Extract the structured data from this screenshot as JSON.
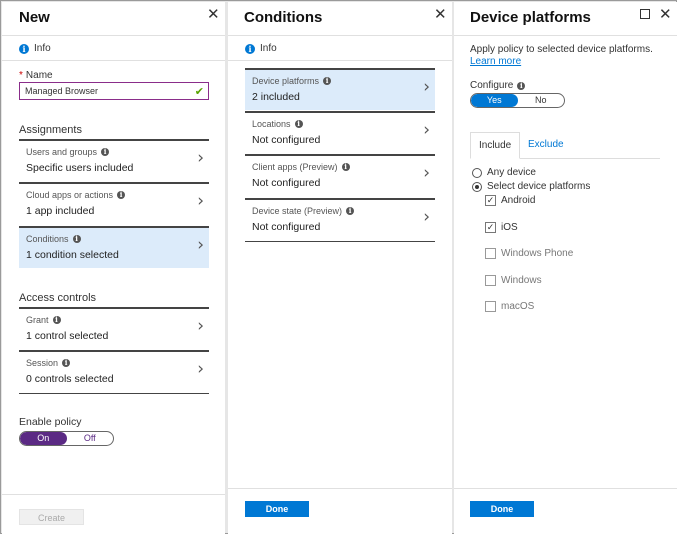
{
  "blade_new": {
    "title": "New",
    "info_label": "Info",
    "name_label": "Name",
    "name_value": "Managed Browser",
    "assignments_heading": "Assignments",
    "assignments": [
      {
        "title": "Users and groups",
        "value": "Specific users included"
      },
      {
        "title": "Cloud apps or actions",
        "value": "1 app included"
      },
      {
        "title": "Conditions",
        "value": "1 condition selected"
      }
    ],
    "access_heading": "Access controls",
    "access": [
      {
        "title": "Grant",
        "value": "1 control selected"
      },
      {
        "title": "Session",
        "value": "0 controls selected"
      }
    ],
    "enable_policy_label": "Enable policy",
    "toggle_on": "On",
    "toggle_off": "Off",
    "create_button": "Create"
  },
  "blade_conditions": {
    "title": "Conditions",
    "info_label": "Info",
    "items": [
      {
        "title": "Device platforms",
        "value": "2 included"
      },
      {
        "title": "Locations",
        "value": "Not configured"
      },
      {
        "title": "Client apps (Preview)",
        "value": "Not configured"
      },
      {
        "title": "Device state (Preview)",
        "value": "Not configured"
      }
    ],
    "done_button": "Done"
  },
  "blade_platforms": {
    "title": "Device platforms",
    "description": "Apply policy to selected device platforms.",
    "learn_more": "Learn more",
    "configure_label": "Configure",
    "toggle_yes": "Yes",
    "toggle_no": "No",
    "tab_include": "Include",
    "tab_exclude": "Exclude",
    "radio_any": "Any device",
    "radio_select": "Select device platforms",
    "platforms": [
      {
        "name": "Android",
        "checked": true
      },
      {
        "name": "iOS",
        "checked": true
      },
      {
        "name": "Windows Phone",
        "checked": false
      },
      {
        "name": "Windows",
        "checked": false
      },
      {
        "name": "macOS",
        "checked": false
      }
    ],
    "done_button": "Done"
  },
  "colors": {
    "accent": "#0078d4",
    "toggle_purple": "#5b2a84",
    "selected_row": "#dcebfa"
  }
}
